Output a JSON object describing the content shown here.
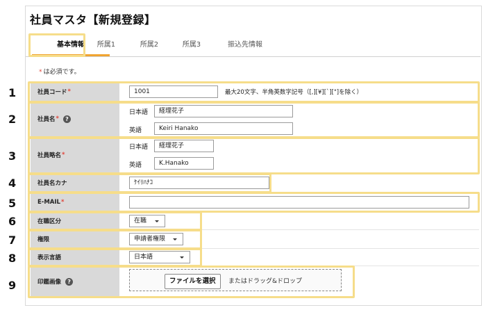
{
  "page_title": "社員マスタ【新規登録】",
  "tabs": [
    {
      "label": "基本情報",
      "active": true
    },
    {
      "label": "所属1",
      "active": false
    },
    {
      "label": "所属2",
      "active": false
    },
    {
      "label": "所属3",
      "active": false
    },
    {
      "label": "振込先情報",
      "active": false
    }
  ],
  "required_note": {
    "star": "*",
    "text": "は必須です。"
  },
  "required_star": "*",
  "help_glyph": "?",
  "callouts": [
    "1",
    "2",
    "3",
    "4",
    "5",
    "6",
    "7",
    "8",
    "9"
  ],
  "fields": {
    "employee_code": {
      "label": "社員コード",
      "value": "1001",
      "hint": "最大20文字、半角英数字記号（[,][¥][`][\"]を除く）"
    },
    "employee_name": {
      "label": "社員名",
      "ja_label": "日本語",
      "ja_value": "経理花子",
      "en_label": "英語",
      "en_value": "Keiri Hanako"
    },
    "employee_short_name": {
      "label": "社員略名",
      "ja_label": "日本語",
      "ja_value": "経理花子",
      "en_label": "英語",
      "en_value": "K.Hanako"
    },
    "employee_kana": {
      "label": "社員名カナ",
      "value": "ｹｲﾘﾊﾅｺ"
    },
    "email": {
      "label": "E-MAIL",
      "value": ""
    },
    "employment_status": {
      "label": "在職区分",
      "selected": "在職"
    },
    "permission": {
      "label": "権限",
      "selected": "申請者権限"
    },
    "display_language": {
      "label": "表示言語",
      "selected": "日本語"
    },
    "seal_image": {
      "label": "印鑑画像",
      "button_label": "ファイルを選択",
      "drop_text": "またはドラッグ&ドロップ"
    }
  },
  "colors": {
    "highlight": "#f6dd8a",
    "tab_underline": "#f0a431",
    "required": "#e0463b",
    "label_bg": "#d9d9d9"
  }
}
